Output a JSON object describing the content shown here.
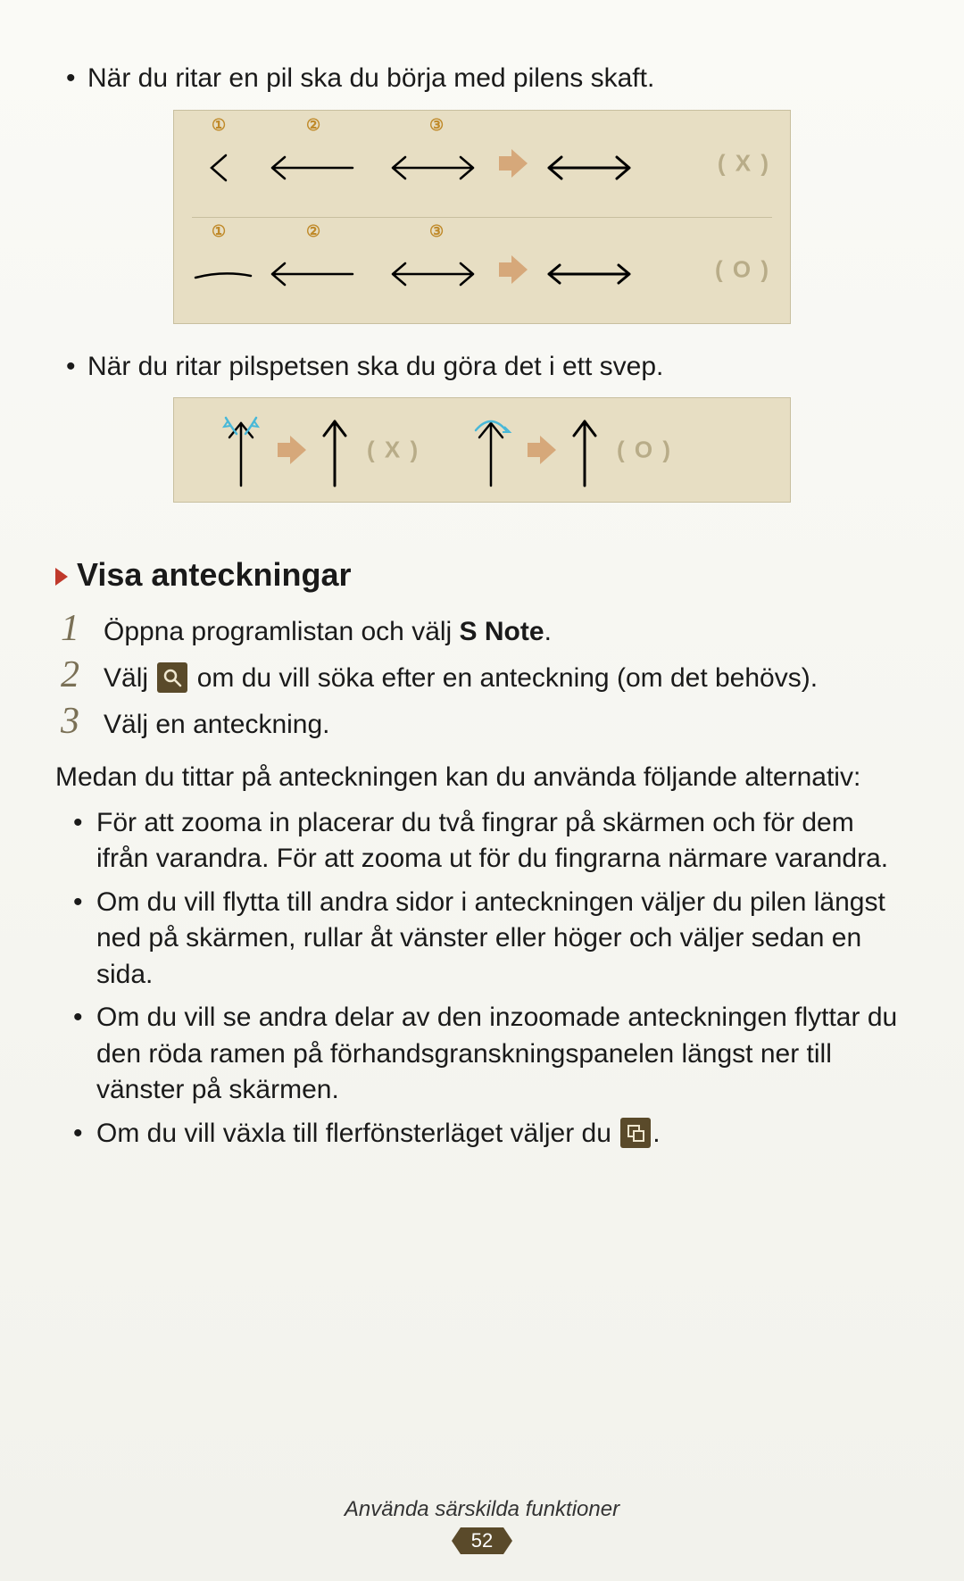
{
  "bullets_top": {
    "b1": "När du ritar en pil ska du börja med pilens skaft.",
    "b2": "När du ritar pilspetsen ska du göra det i ett svep."
  },
  "diagram1": {
    "labels": {
      "n1": "①",
      "n2": "②",
      "n3": "③"
    },
    "wrong": "( X )",
    "right": "( O )"
  },
  "diagram2": {
    "wrong": "( X )",
    "right": "( O )"
  },
  "section": {
    "title": "Visa anteckningar"
  },
  "steps": {
    "s1_num": "1",
    "s1_a": "Öppna programlistan och välj ",
    "s1_b": "S Note",
    "s1_c": ".",
    "s2_num": "2",
    "s2_a": "Välj ",
    "s2_b": " om du vill söka efter en anteckning (om det behövs).",
    "s3_num": "3",
    "s3_a": "Välj en anteckning."
  },
  "para1": "Medan du tittar på anteckningen kan du använda följande alternativ:",
  "opts": {
    "o1": "För att zooma in placerar du två fingrar på skärmen och för dem ifrån varandra. För att zooma ut för du fingrarna närmare varandra.",
    "o2": "Om du vill flytta till andra sidor i anteckningen väljer du pilen längst ned på skärmen, rullar åt vänster eller höger och väljer sedan en sida.",
    "o3": "Om du vill se andra delar av den inzoomade anteckningen flyttar du den röda ramen på förhandsgranskningspanelen längst ner till vänster på skärmen.",
    "o4_a": "Om du vill växla till flerfönsterläget väljer du ",
    "o4_b": "."
  },
  "footer": {
    "section": "Använda särskilda funktioner",
    "page": "52"
  }
}
